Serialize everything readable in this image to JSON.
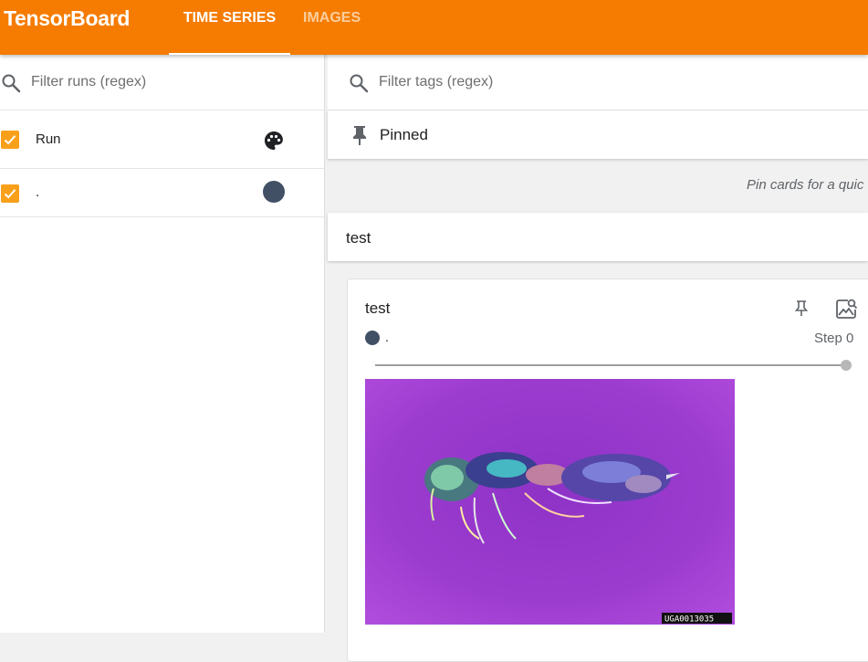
{
  "header": {
    "brand": "TensorBoard",
    "tabs": [
      {
        "label": "TIME SERIES",
        "active": true
      },
      {
        "label": "IMAGES",
        "active": false
      }
    ],
    "colors": {
      "bar": "#f57c00"
    }
  },
  "sidebar": {
    "filter_placeholder": "Filter runs (regex)",
    "header_row": {
      "label": "Run",
      "checked": true,
      "icon": "palette-icon"
    },
    "runs": [
      {
        "label": ".",
        "checked": true,
        "color": "#425066"
      }
    ]
  },
  "main": {
    "filter_placeholder": "Filter tags (regex)",
    "pinned": {
      "title": "Pinned",
      "icon": "pin-icon",
      "empty_message": "Pin cards for a quic"
    },
    "group": {
      "title": "test",
      "cards": [
        {
          "title": "test",
          "run": ".",
          "run_color": "#425066",
          "step_label": "Step 0",
          "slider_value": 1.0,
          "image_caption": "UGA0013035"
        }
      ]
    }
  }
}
